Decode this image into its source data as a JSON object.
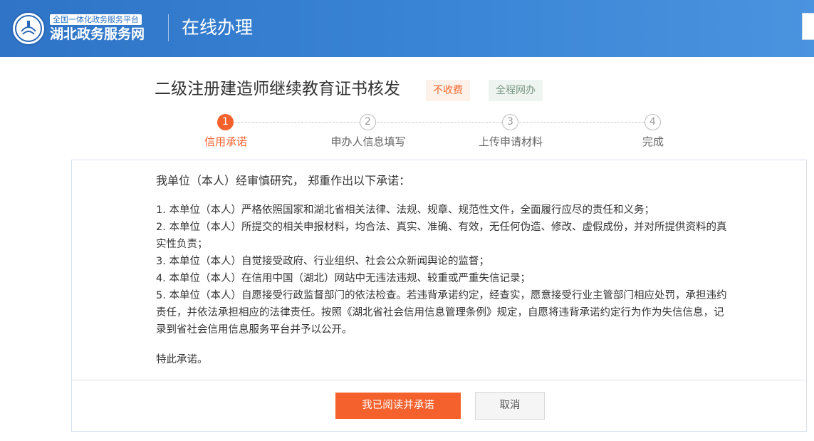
{
  "header": {
    "logo_tag": "全国一体化政务服务平台",
    "logo_name": "湖北政务服务网",
    "title": "在线办理"
  },
  "service": {
    "title": "二级注册建造师继续教育证书核发",
    "badges": [
      "不收费",
      "全程网办"
    ]
  },
  "steps": [
    {
      "number": "1",
      "label": "信用承诺",
      "active": true
    },
    {
      "number": "2",
      "label": "申办人信息填写",
      "active": false
    },
    {
      "number": "3",
      "label": "上传申请材料",
      "active": false
    },
    {
      "number": "4",
      "label": "完成",
      "active": false
    }
  ],
  "pledge": {
    "intro": "我单位（本人）经审慎研究， 郑重作出以下承诺：",
    "clauses": [
      "1. 本单位（本人）严格依照国家和湖北省相关法律、法规、规章、规范性文件，全面履行应尽的责任和义务；",
      "2. 本单位（本人）所提交的相关申报材料，均合法、真实、准确、有效，无任何伪造、修改、虚假成份，并对所提供资料的真实性负责；",
      "3. 本单位（本人）自觉接受政府、行业组织、社会公众新闻舆论的监督；",
      "4. 本单位（本人）在信用中国（湖北）网站中无违法违规、较重或严重失信记录；",
      "5. 本单位（本人）自愿接受行政监督部门的依法检查。若违背承诺约定，经查实，愿意接受行业主管部门相应处罚，承担违约责任，并依法承担相应的法律责任。按照《湖北省社会信用信息管理条例》规定，自愿将违背承诺约定行为作为失信信息，记录到省社会信用信息服务平台并予以公开。"
    ],
    "closing": "特此承诺。"
  },
  "buttons": {
    "agree": "我已阅读并承诺",
    "cancel": "取消"
  },
  "colors": {
    "header_blue": "#3a85d6",
    "accent_orange": "#f5612d"
  },
  "icons": {
    "logo": "hubei-gov-logo-icon"
  }
}
